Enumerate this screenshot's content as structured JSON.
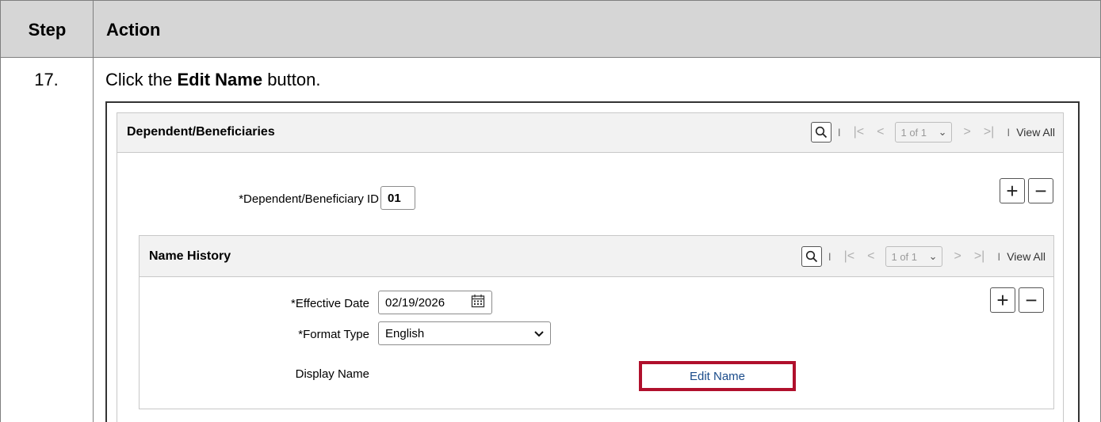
{
  "table": {
    "header_step": "Step",
    "header_action": "Action",
    "step_number": "17.",
    "instruction_prefix": "Click the ",
    "instruction_bold": "Edit Name",
    "instruction_suffix": " button."
  },
  "dependent_panel": {
    "title": "Dependent/Beneficiaries",
    "pager": "1 of 1",
    "view_all": "View All",
    "id_label": "*Dependent/Beneficiary ID",
    "id_value": "01"
  },
  "name_history_panel": {
    "title": "Name History",
    "pager": "1 of 1",
    "view_all": "View All",
    "effective_date_label": "*Effective Date",
    "effective_date_value": "02/19/2026",
    "format_type_label": "*Format Type",
    "format_type_value": "English",
    "display_name_label": "Display Name",
    "edit_name_button": "Edit Name"
  },
  "colors": {
    "header_bg": "#d6d6d6",
    "highlight": "#b0102c",
    "link_text": "#1a4b8a"
  },
  "icons": [
    "search-icon",
    "first-page-icon",
    "prev-page-icon",
    "next-page-icon",
    "last-page-icon",
    "chevron-down-icon",
    "calendar-icon",
    "add-row-icon",
    "delete-row-icon"
  ]
}
